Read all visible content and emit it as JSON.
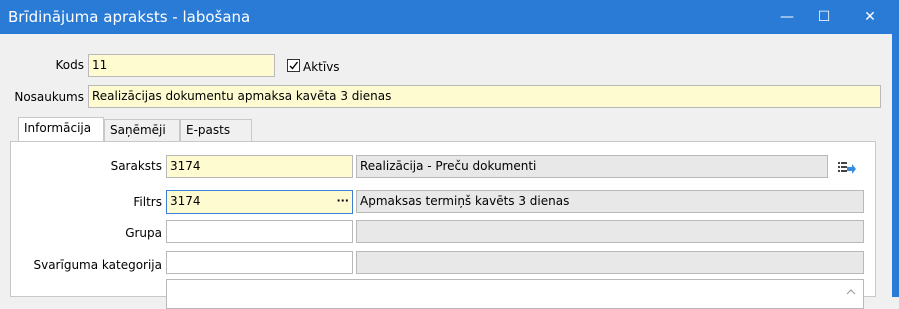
{
  "window": {
    "title": "Brīdinājuma apraksts - labošana",
    "minimize": "—",
    "maximize": "☐",
    "close": "✕"
  },
  "form": {
    "kods_label": "Kods",
    "kods_value": "11",
    "aktivs_label": "Aktīvs",
    "aktivs_checked": true,
    "nosaukums_label": "Nosaukums",
    "nosaukums_value": "Realizācijas dokumentu apmaksa kavēta 3 dienas"
  },
  "tabs": [
    {
      "label": "Informācija",
      "active": true
    },
    {
      "label": "Saņēmēji",
      "active": false
    },
    {
      "label": "E-pasts",
      "active": false
    }
  ],
  "info": {
    "saraksts_label": "Saraksts",
    "saraksts_code": "3174",
    "saraksts_desc": "Realizācija - Preču dokumenti",
    "filtrs_label": "Filtrs",
    "filtrs_code": "3174",
    "filtrs_ellipsis": "···",
    "filtrs_desc": "Apmaksas termiņš kavēts 3 dienas",
    "grupa_label": "Grupa",
    "grupa_code": "",
    "grupa_desc": "",
    "svariguma_label": "Svarīguma kategorija",
    "svariguma_code": "",
    "svariguma_desc": ""
  },
  "colors": {
    "titlebar": "#2a7bd6",
    "yellow_field": "#fffbd0",
    "focus_border": "#3c7fd9"
  }
}
